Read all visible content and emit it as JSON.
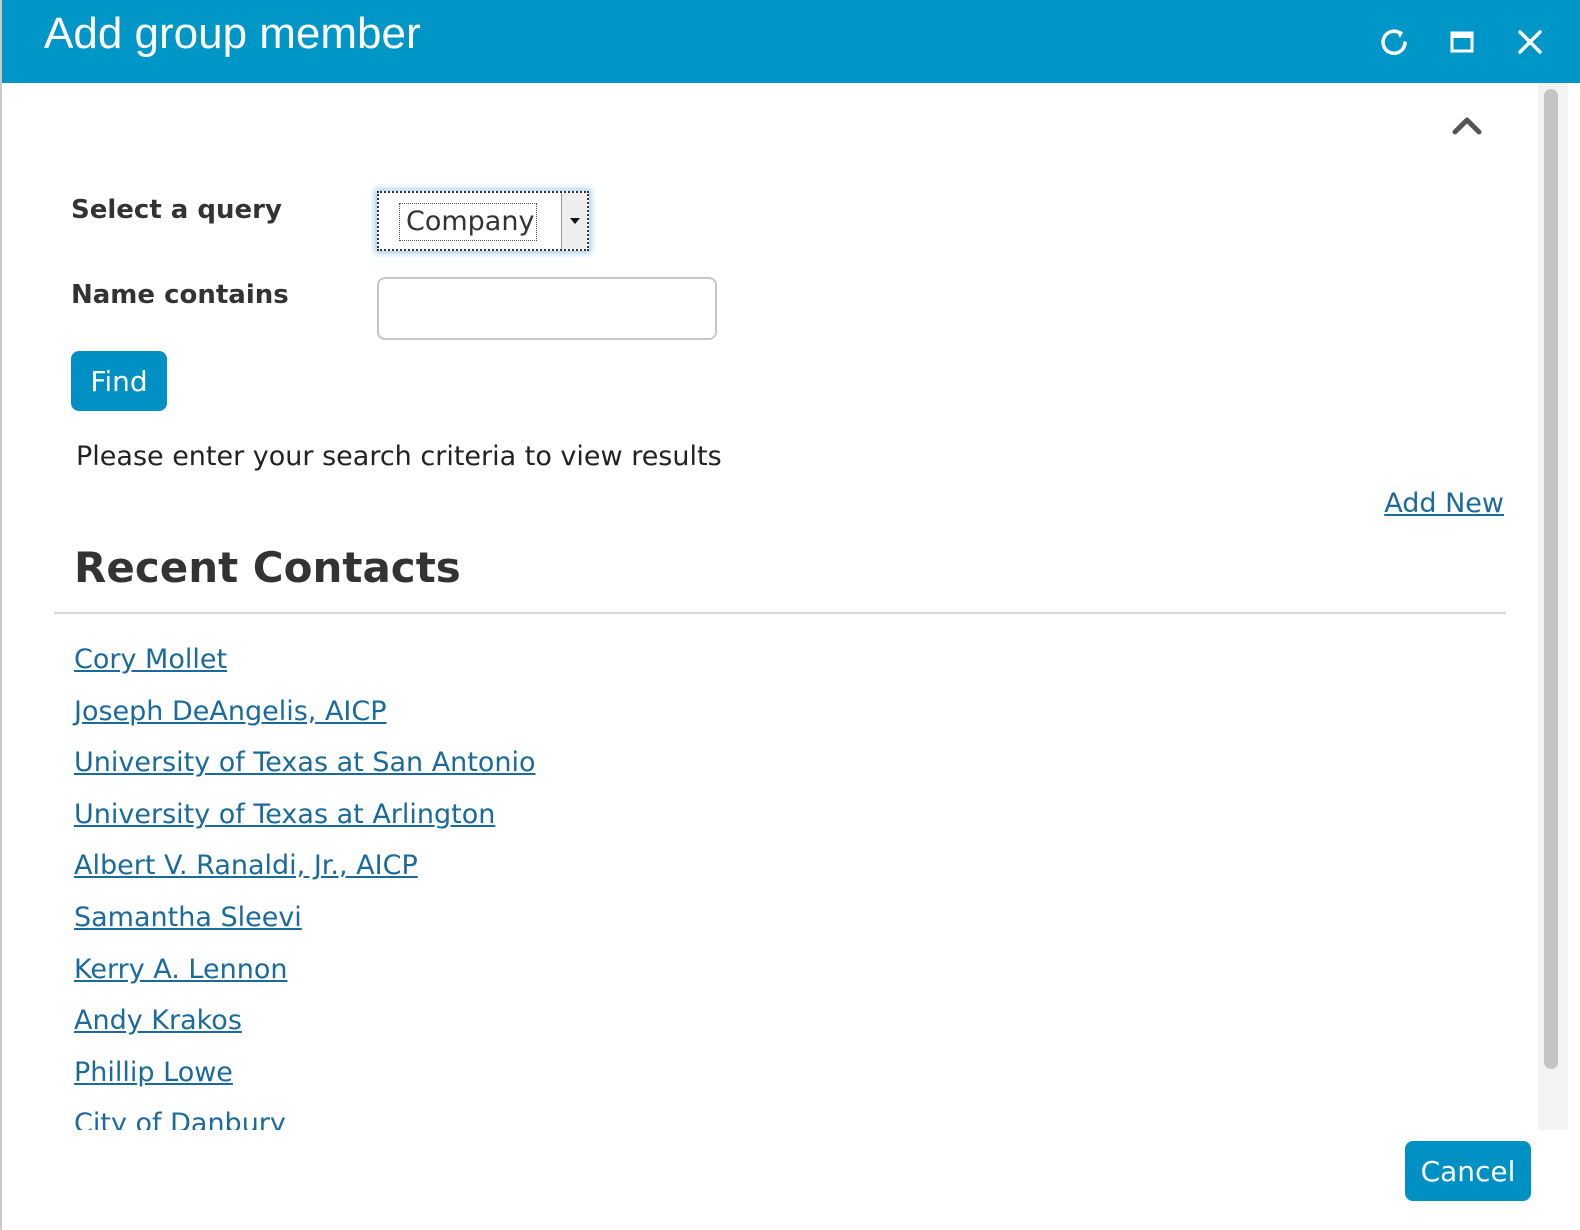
{
  "dialog": {
    "title": "Add group member",
    "titlebar_buttons": [
      "refresh-icon",
      "maximize-icon",
      "close-icon"
    ],
    "accent_color": "#0096c8"
  },
  "form": {
    "collapse_icon": "chevron-up-icon",
    "query_label": "Select a query",
    "query_value": "Company",
    "name_label": "Name contains",
    "name_value": "",
    "find_label": "Find",
    "hint": "Please enter your search criteria to view results",
    "add_new_label": "Add New"
  },
  "recent": {
    "title": "Recent Contacts",
    "items": [
      "Cory Mollet",
      "Joseph DeAngelis, AICP",
      "University of Texas at San Antonio",
      "University of Texas at Arlington",
      "Albert V. Ranaldi, Jr., AICP",
      "Samantha Sleevi",
      "Kerry A. Lennon",
      "Andy Krakos",
      "Phillip Lowe",
      "City of Danbury"
    ]
  },
  "footer": {
    "cancel_label": "Cancel"
  }
}
